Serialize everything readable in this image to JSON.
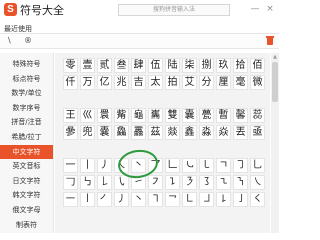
{
  "titlebar": {
    "logo_letter": "S",
    "title": "符号大全",
    "search_placeholder": "搜狗拼音输入法",
    "minimize": "—",
    "close": "×"
  },
  "recent": {
    "label": "最近使用",
    "symbols": [
      "\\",
      "®"
    ]
  },
  "sidebar": {
    "items": [
      "特殊符号",
      "标点符号",
      "数学/单位",
      "数字序号",
      "拼音/注音",
      "希腊/拉丁",
      "中文字符",
      "英文音标",
      "日文字符",
      "韩文字符",
      "俄文字母",
      "制表符"
    ],
    "active_index": 6
  },
  "grid1": {
    "rows": [
      [
        "零",
        "壹",
        "贰",
        "叁",
        "肆",
        "伍",
        "陆",
        "柒",
        "捌",
        "玖",
        "拾",
        "佰"
      ],
      [
        "仟",
        "万",
        "亿",
        "兆",
        "吉",
        "太",
        "拍",
        "艾",
        "分",
        "厘",
        "毫",
        "微"
      ]
    ]
  },
  "grid2": {
    "rows": [
      [
        "王",
        "巛",
        "睘",
        "觜",
        "龜",
        "巂",
        "雙",
        "囊",
        "甍",
        "暫",
        "馨",
        "蕊"
      ],
      [
        "曑",
        "兜",
        "嚢",
        "鱻",
        "靐",
        "茲",
        "燚",
        "鑫",
        "淼",
        "焱",
        "丟",
        "亟"
      ]
    ]
  },
  "grid3": {
    "rows": [
      [
        "一",
        "丨",
        "丿",
        "㇏",
        "丶",
        "乛",
        "𠃊",
        "㇃",
        "㇄",
        "ㄱ",
        "㇆",
        "乚"
      ],
      [
        "𠃌",
        "㇉",
        "𠄌",
        "㇂",
        "㇀",
        "㇇",
        "㇊",
        "㇋",
        "㇌",
        "㇍",
        "㇎",
        "㇏"
      ],
      [
        "㇐",
        "㇑",
        "㇒",
        "㇓",
        "㇔",
        "㇕",
        "㇖",
        "㇗",
        "㇘",
        "㇙",
        "㇚",
        "㇛"
      ]
    ]
  },
  "colors": {
    "accent": "#e8532a",
    "annotation": "#2e9a3e"
  },
  "icons": {
    "logo": "sogou-logo-icon",
    "trash": "trash-icon",
    "scroll_up": "scroll-up-icon"
  }
}
